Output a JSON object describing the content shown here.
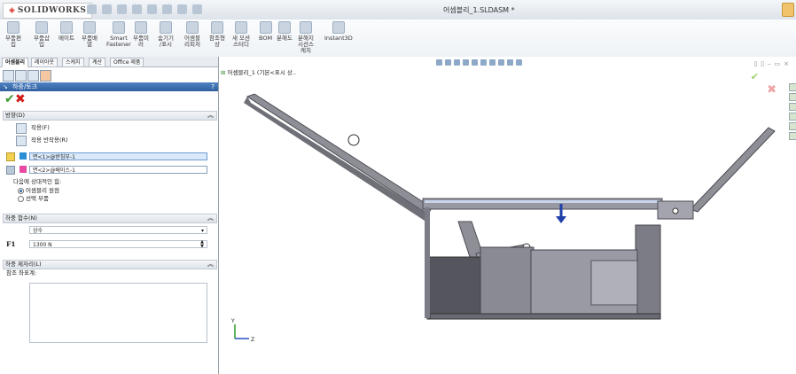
{
  "app": {
    "logo_text": "SOLIDWORKS",
    "document_title": "어셈블리_1.SLDASM *"
  },
  "ribbon": {
    "buttons": [
      "부품편\n집",
      "부품삽\n입",
      "메이트",
      "부품배\n열",
      "Smart\nFastener",
      "부품미\n러",
      "숨기기\n/표시",
      "어셈블\n리피처",
      "참조형\n상",
      "새 모션\n스터디",
      "BOM",
      "분해도",
      "분해지\n시선스\n케치",
      "Instant3D"
    ]
  },
  "tabs": [
    "어셈블리",
    "레이아웃",
    "스케치",
    "계산",
    "Office 제품"
  ],
  "pm": {
    "title": "하중/토크",
    "help": "?",
    "ok_glyph": "✔",
    "cancel_glyph": "✖",
    "type_section": "방향(D)",
    "opt_force": "작용(F)",
    "opt_reaction": "작용 반작용(R)",
    "face1": "면<1>@받침부-1",
    "face2": "면<2>@베이스-1",
    "relative_label": "다음에 상대적인 힘:",
    "radio_origin": "어셈블리 원점",
    "radio_selected": "선택 부품",
    "func_section": "하중 함수(N)",
    "func_value": "상수",
    "force_symbol": "F1",
    "force_value": "1300 N",
    "loc_section": "하중 제자리(L)",
    "loc_label": "참조 좌표계:"
  },
  "viewport": {
    "tree_label": "어셈블리_1 (기본<표시 상..",
    "triad_y": "Y",
    "triad_z": "Z"
  },
  "colors": {
    "pm_header": "#2f5f9e",
    "ok": "#3a9a2a",
    "cancel": "#d11b1b",
    "arrow": "#1f3fa8"
  }
}
